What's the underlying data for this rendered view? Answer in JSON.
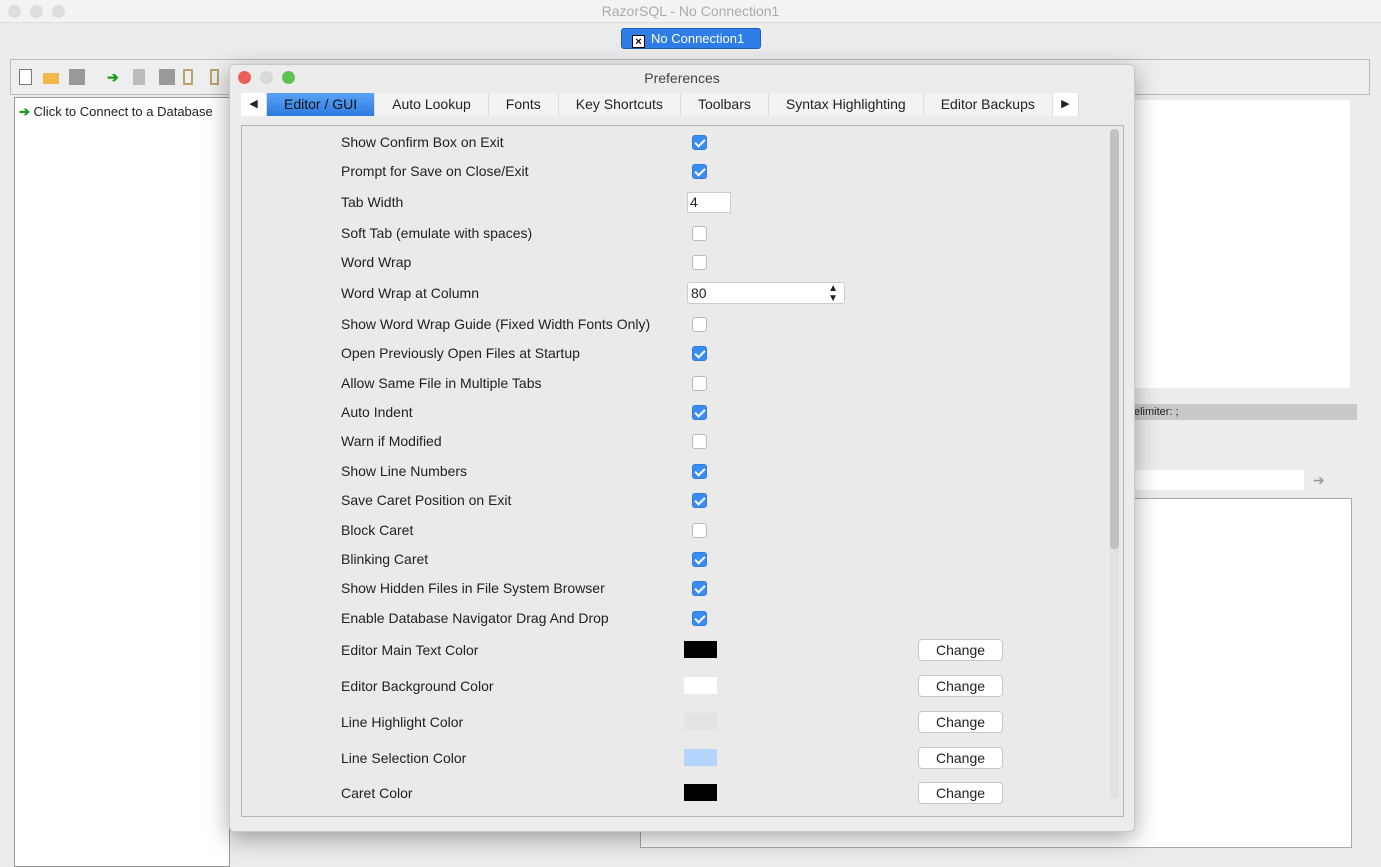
{
  "app": {
    "title": "RazorSQL - No Connection1",
    "connection_tab": "No Connection1",
    "nav_item": "Click to Connect to a Database",
    "status_text": "elimiter: ;"
  },
  "dialog": {
    "title": "Preferences",
    "tabs": [
      "Editor / GUI",
      "Auto Lookup",
      "Fonts",
      "Key Shortcuts",
      "Toolbars",
      "Syntax Highlighting",
      "Editor Backups"
    ],
    "active_tab": "Editor / GUI",
    "checkbox_rows": [
      {
        "label": "Show Confirm Box on Exit",
        "checked": true
      },
      {
        "label": "Prompt for Save on Close/Exit",
        "checked": true
      },
      {
        "label": "Soft Tab (emulate with spaces)",
        "checked": false
      },
      {
        "label": "Word Wrap",
        "checked": false
      },
      {
        "label": "Show Word Wrap Guide (Fixed Width Fonts Only)",
        "checked": false
      },
      {
        "label": "Open Previously Open Files at Startup",
        "checked": true
      },
      {
        "label": "Allow Same File in Multiple Tabs",
        "checked": false
      },
      {
        "label": "Auto Indent",
        "checked": true
      },
      {
        "label": "Warn if Modified",
        "checked": false
      },
      {
        "label": "Show Line Numbers",
        "checked": true
      },
      {
        "label": "Save Caret Position on Exit",
        "checked": true
      },
      {
        "label": "Block Caret",
        "checked": false
      },
      {
        "label": "Blinking Caret",
        "checked": true
      },
      {
        "label": "Show Hidden Files in File System Browser",
        "checked": true
      },
      {
        "label": "Enable Database Navigator Drag And Drop",
        "checked": true
      }
    ],
    "tab_width": {
      "label": "Tab Width",
      "value": "4"
    },
    "wrap_column": {
      "label": "Word Wrap at Column",
      "value": "80"
    },
    "color_rows": [
      {
        "label": "Editor Main Text Color",
        "color": "#000000",
        "button": "Change"
      },
      {
        "label": "Editor Background Color",
        "color": "#ffffff",
        "button": "Change"
      },
      {
        "label": "Line Highlight Color",
        "color": "#e4e4e4",
        "button": "Change"
      },
      {
        "label": "Line Selection Color",
        "color": "#b3d4fc",
        "button": "Change"
      },
      {
        "label": "Caret Color",
        "color": "#000000",
        "button": "Change"
      }
    ]
  }
}
